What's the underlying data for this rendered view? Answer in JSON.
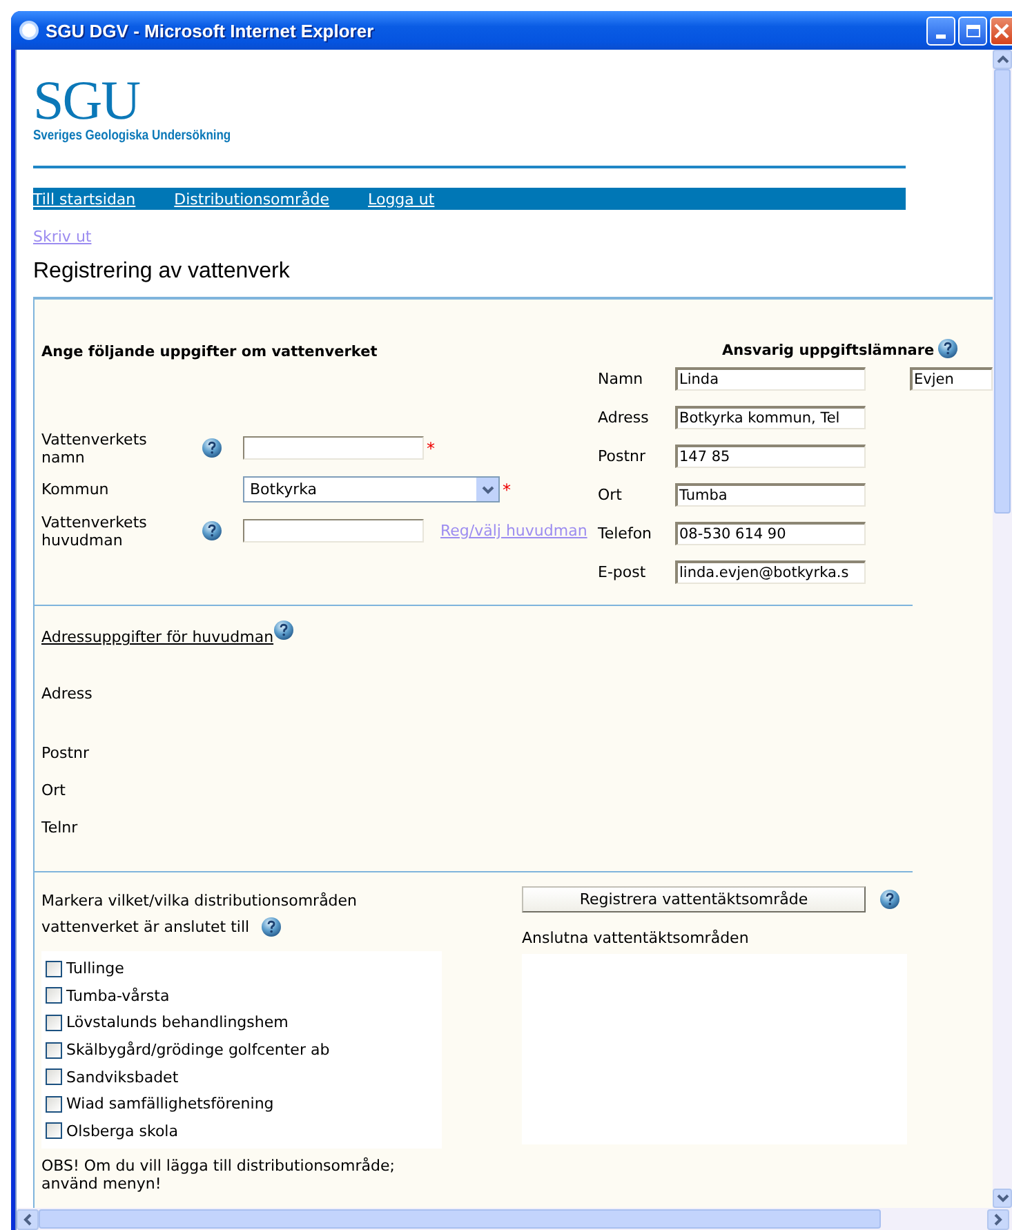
{
  "window": {
    "title": "SGU DGV - Microsoft Internet Explorer"
  },
  "logo": {
    "text": "SGU",
    "subtitle": "Sveriges Geologiska Undersökning"
  },
  "nav": [
    {
      "label": "Till startsidan"
    },
    {
      "label": "Distributionsområde"
    },
    {
      "label": "Logga ut"
    }
  ],
  "print_link": "Skriv ut",
  "heading": "Registrering av vattenverk",
  "plant": {
    "title": "Ange följande uppgifter om vattenverket",
    "fields": [
      {
        "kind": "text",
        "label": "Vattenverkets namn",
        "help": true,
        "required_mark": "*"
      },
      {
        "kind": "select",
        "label": "Kommun",
        "help": false,
        "value": "Botkyrka",
        "required_mark": "*"
      },
      {
        "kind": "text",
        "label": "Vattenverkets huvudman",
        "help": true,
        "link": "Reg/välj huvudman"
      }
    ]
  },
  "reporter": {
    "title": "Ansvarig uppgiftslämnare",
    "fields": [
      {
        "label": "Namn",
        "value": "Linda",
        "value_2": "Evjen"
      },
      {
        "label": "Adress",
        "value": "Botkyrka kommun, Tel"
      },
      {
        "label": "Postnr",
        "value": "147 85"
      },
      {
        "label": "Ort",
        "value": "Tumba"
      },
      {
        "label": "Telefon",
        "value": "08-530 614 90"
      },
      {
        "label": "E-post",
        "value": "linda.evjen@botkyrka.s"
      }
    ]
  },
  "owner_address": {
    "title": "Adressuppgifter för huvudman",
    "labels": [
      "Adress",
      "Postnr",
      "Ort",
      "Telnr"
    ]
  },
  "distribution": {
    "prompt_1": "Markera vilket/vilka distributionsområden",
    "prompt_2": "vattenverket är anslutet till",
    "areas": [
      {
        "label": "Tullinge",
        "checked": false
      },
      {
        "label": "Tumba-vårsta",
        "checked": false
      },
      {
        "label": "Lövstalunds behandlingshem",
        "checked": false
      },
      {
        "label": "Skälbygård/grödinge golfcenter ab",
        "checked": false
      },
      {
        "label": "Sandviksbadet",
        "checked": false
      },
      {
        "label": "Wiad samfällighetsförening",
        "checked": false
      },
      {
        "label": "Olsberga skola",
        "checked": false
      }
    ],
    "note": "OBS! Om du vill lägga till distributionsområde; använd menyn!",
    "register_button": "Registrera vattentäktsområde",
    "connected_title": "Anslutna vattentäktsområden"
  }
}
